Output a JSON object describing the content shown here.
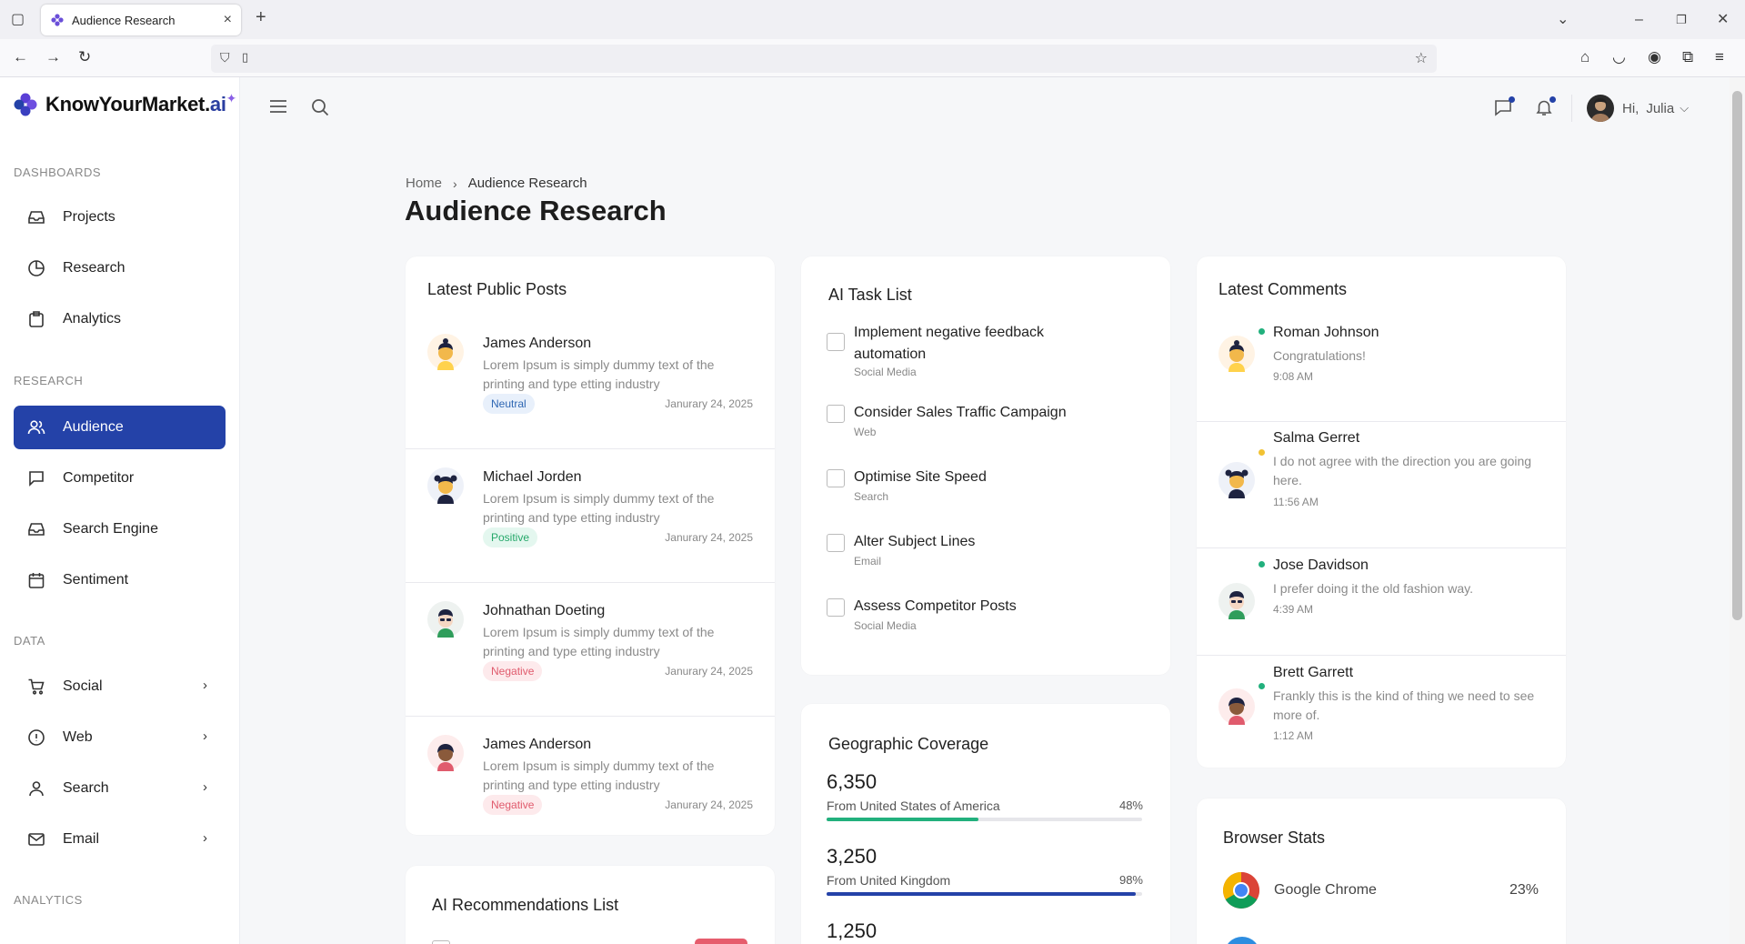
{
  "browser": {
    "tab_title": "Audience Research"
  },
  "logo": {
    "main": "KnowYourMarket.",
    "ai": "ai"
  },
  "sidebar": {
    "sections": [
      {
        "label": "DASHBOARDS"
      },
      {
        "label": "RESEARCH"
      },
      {
        "label": "DATA"
      },
      {
        "label": "ANALYTICS"
      }
    ],
    "items": [
      {
        "label": "Projects",
        "icon": "inbox-icon"
      },
      {
        "label": "Research",
        "icon": "pie-chart-icon"
      },
      {
        "label": "Analytics",
        "icon": "clipboard-icon"
      },
      {
        "label": "Audience",
        "icon": "users-icon",
        "active": true
      },
      {
        "label": "Competitor",
        "icon": "message-square-icon"
      },
      {
        "label": "Search Engine",
        "icon": "inbox-icon"
      },
      {
        "label": "Sentiment",
        "icon": "calendar-icon"
      },
      {
        "label": "Social",
        "icon": "cart-icon"
      },
      {
        "label": "Web",
        "icon": "alert-circle-icon"
      },
      {
        "label": "Search",
        "icon": "user-icon"
      },
      {
        "label": "Email",
        "icon": "mail-icon"
      }
    ]
  },
  "header": {
    "greeting": "Hi,",
    "user": "Julia"
  },
  "breadcrumb": {
    "home": "Home",
    "current": "Audience Research"
  },
  "page_title": "Audience Research",
  "posts": {
    "title": "Latest Public Posts",
    "items": [
      {
        "name": "James Anderson",
        "text": "Lorem Ipsum is simply dummy text of the printing and type etting industry",
        "badge": "Neutral",
        "date": "Janurary 24, 2025"
      },
      {
        "name": "Michael Jorden",
        "text": "Lorem Ipsum is simply dummy text of the printing and type etting industry",
        "badge": "Positive",
        "date": "Janurary 24, 2025"
      },
      {
        "name": "Johnathan Doeting",
        "text": "Lorem Ipsum is simply dummy text of the printing and type etting industry",
        "badge": "Negative",
        "date": "Janurary 24, 2025"
      },
      {
        "name": "James Anderson",
        "text": "Lorem Ipsum is simply dummy text of the printing and type etting industry",
        "badge": "Negative",
        "date": "Janurary 24, 2025"
      }
    ]
  },
  "recommendations": {
    "title": "AI Recommendations List"
  },
  "tasks": {
    "title": "AI Task List",
    "items": [
      {
        "text": "Implement negative feedback automation",
        "tag": "Social Media"
      },
      {
        "text": "Consider Sales Traffic Campaign",
        "tag": "Web"
      },
      {
        "text": "Optimise Site Speed",
        "tag": "Search"
      },
      {
        "text": "Alter Subject Lines",
        "tag": "Email"
      },
      {
        "text": "Assess Competitor Posts",
        "tag": "Social Media"
      }
    ]
  },
  "geo": {
    "title": "Geographic Coverage",
    "items": [
      {
        "value": "6,350",
        "label": "From United States of America",
        "pct": "48%",
        "fill": 0.48,
        "color": "#22b07d"
      },
      {
        "value": "3,250",
        "label": "From United Kingdom",
        "pct": "98%",
        "fill": 0.98,
        "color": "#2442a8"
      },
      {
        "value": "1,250"
      }
    ]
  },
  "comments": {
    "title": "Latest Comments",
    "items": [
      {
        "name": "Roman Johnson",
        "text": "Congratulations!",
        "time": "9:08 AM",
        "status": "#22b07d"
      },
      {
        "name": "Salma Gerret",
        "text": "I do not agree with the direction you are going here.",
        "time": "11:56 AM",
        "status": "#f2c233"
      },
      {
        "name": "Jose Davidson",
        "text": "I prefer doing it the old fashion way.",
        "time": "4:39 AM",
        "status": "#22b07d"
      },
      {
        "name": "Brett Garrett",
        "text": "Frankly this is the kind of thing we need to see more of.",
        "time": "1:12 AM",
        "status": "#22b07d"
      }
    ]
  },
  "browser_stats": {
    "title": "Browser Stats",
    "items": [
      {
        "name": "Google Chrome",
        "pct": "23%"
      }
    ]
  }
}
